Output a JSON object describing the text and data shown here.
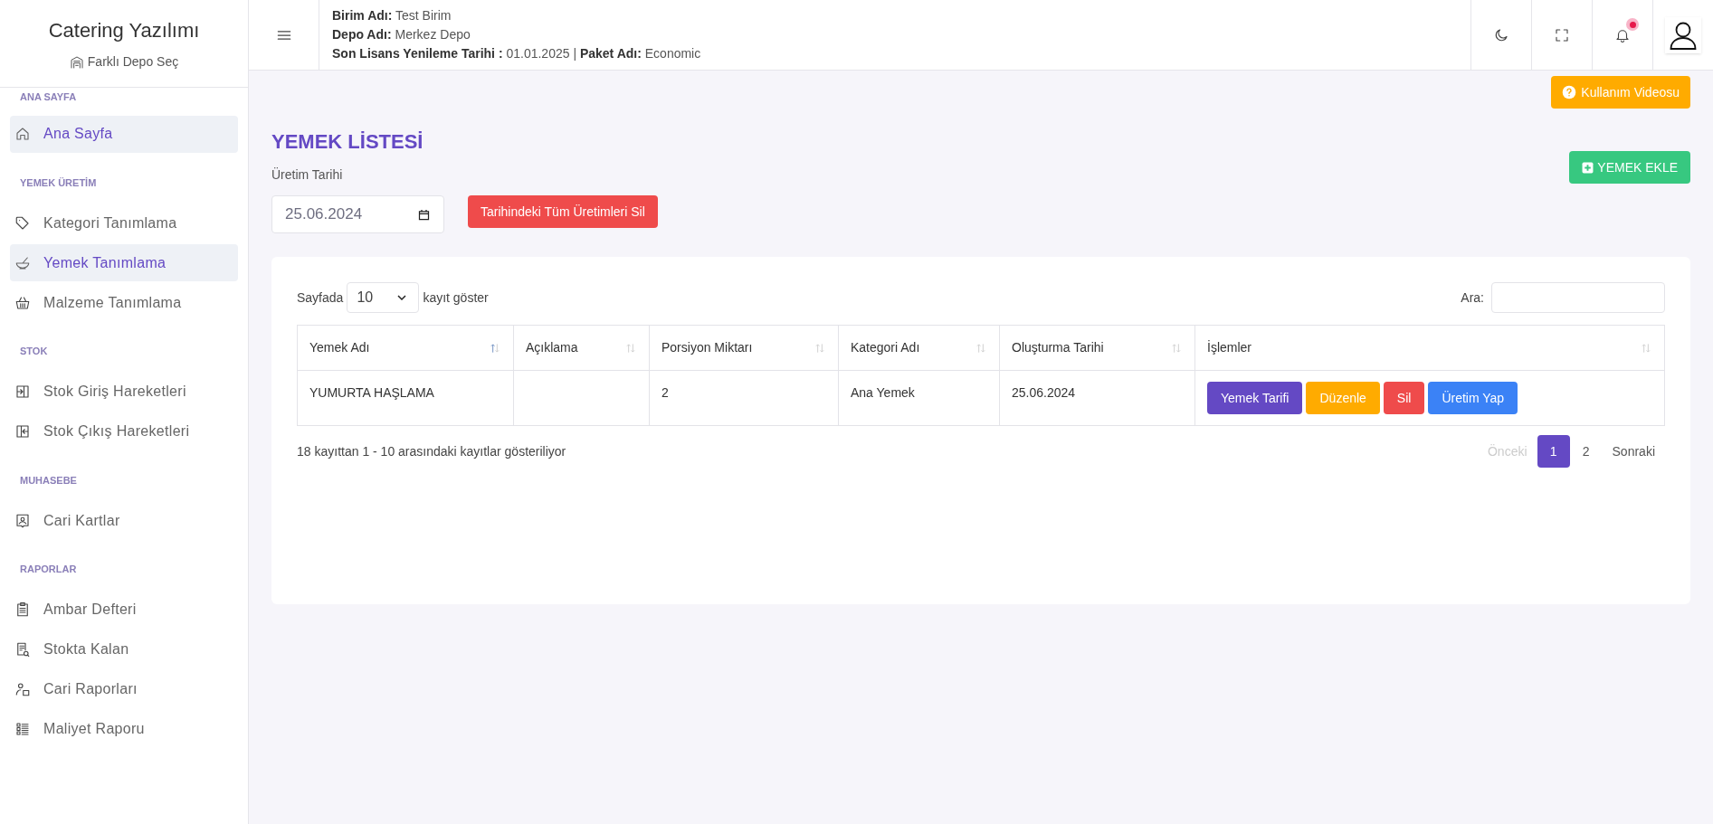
{
  "sidebar": {
    "title": "Catering Yazılımı",
    "depot_link": "Farklı Depo Seç",
    "sections": [
      {
        "heading": "ANA SAYFA",
        "items": [
          {
            "label": "Ana Sayfa",
            "selected": true,
            "highlighted": true
          }
        ]
      },
      {
        "heading": "YEMEK ÜRETİM",
        "items": [
          {
            "label": "Kategori Tanımlama",
            "selected": false,
            "highlighted": false
          },
          {
            "label": "Yemek Tanımlama",
            "selected": true,
            "highlighted": true
          },
          {
            "label": "Malzeme Tanımlama",
            "selected": false,
            "highlighted": false
          }
        ]
      },
      {
        "heading": "STOK",
        "items": [
          {
            "label": "Stok Giriş Hareketleri",
            "selected": false,
            "highlighted": false
          },
          {
            "label": "Stok Çıkış Hareketleri",
            "selected": false,
            "highlighted": false
          }
        ]
      },
      {
        "heading": "MUHASEBE",
        "items": [
          {
            "label": "Cari Kartlar",
            "selected": false,
            "highlighted": false
          }
        ]
      },
      {
        "heading": "RAPORLAR",
        "items": [
          {
            "label": "Ambar Defteri",
            "selected": false,
            "highlighted": false
          },
          {
            "label": "Stokta Kalan",
            "selected": false,
            "highlighted": false
          },
          {
            "label": "Cari Raporları",
            "selected": false,
            "highlighted": false
          },
          {
            "label": "Maliyet Raporu",
            "selected": false,
            "highlighted": false
          }
        ]
      }
    ]
  },
  "header": {
    "info_lines": [
      "**Birim Adı:** Test Birim",
      "**Depo Adı:** Merkez Depo",
      "**Son Lisans Yenileme Tarihi :** 01.01.2025 | **Paket Adı:** Economic"
    ],
    "has_notification": true
  },
  "help_button": "Kullanım Videosu",
  "page_title": "YEMEK LİSTESİ",
  "date_field": {
    "label": "Üretim Tarihi",
    "value": "25.06.2024"
  },
  "delete_all_button": "Tarihindeki Tüm Üretimleri Sil",
  "add_button": "YEMEK EKLE",
  "table": {
    "length_prefix": "Sayfada",
    "length_value": "10",
    "length_suffix": "kayıt göster",
    "search_label": "Ara:",
    "columns": [
      {
        "label": "Yemek Adı",
        "sorted": true
      },
      {
        "label": "Açıklama",
        "sorted": false
      },
      {
        "label": "Porsiyon Miktarı",
        "sorted": false
      },
      {
        "label": "Kategori Adı",
        "sorted": false
      },
      {
        "label": "Oluşturma Tarihi",
        "sorted": false
      },
      {
        "label": "İşlemler",
        "sorted": false
      }
    ],
    "rows": [
      {
        "cells": [
          "YUMURTA HAŞLAMA",
          "",
          "2",
          "Ana Yemek",
          "25.06.2024"
        ],
        "actions": [
          {
            "label": "Yemek Tarifi",
            "kind": "recipe"
          },
          {
            "label": "Düzenle",
            "kind": "edit"
          },
          {
            "label": "Sil",
            "kind": "delete"
          },
          {
            "label": "Üretim Yap",
            "kind": "produce"
          }
        ]
      }
    ],
    "info": "18 kayıttan 1 - 10 arasındaki kayıtlar gösteriliyor",
    "pagination": {
      "previous": {
        "label": "Önceki",
        "disabled": true
      },
      "pages": [
        {
          "label": "1",
          "selected": true
        },
        {
          "label": "2",
          "selected": false
        }
      ],
      "next": {
        "label": "Sonraki",
        "disabled": false
      }
    }
  }
}
